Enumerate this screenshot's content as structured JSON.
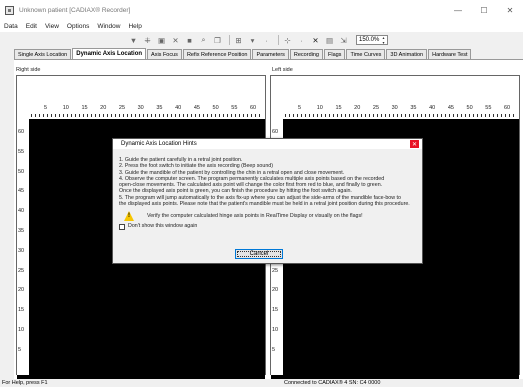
{
  "window": {
    "title": "Unknown patient [CADIAX® Recorder]",
    "minimize": "—",
    "maximize": "☐",
    "close": "✕"
  },
  "menu": [
    "Data",
    "Edit",
    "View",
    "Options",
    "Window",
    "Help"
  ],
  "toolbar": {
    "zoom": "150.0%"
  },
  "tabs": [
    {
      "label": "Single Axis Location",
      "active": false
    },
    {
      "label": "Dynamic Axis Location",
      "active": true
    },
    {
      "label": "Axis Focus",
      "active": false
    },
    {
      "label": "Refix Reference Position",
      "active": false
    },
    {
      "label": "Parameters",
      "active": false
    },
    {
      "label": "Recording",
      "active": false
    },
    {
      "label": "Flags",
      "active": false
    },
    {
      "label": "Time Curves",
      "active": false
    },
    {
      "label": "3D Animation",
      "active": false
    },
    {
      "label": "Hardware Test",
      "active": false
    }
  ],
  "panels": {
    "right_side": "Right side",
    "left_side": "Left side"
  },
  "ruler": {
    "top_ticks": [
      "5",
      "10",
      "15",
      "20",
      "25",
      "30",
      "35",
      "40",
      "45",
      "50",
      "55",
      "60"
    ],
    "left_ticks": [
      "60",
      "55",
      "50",
      "45",
      "40",
      "35",
      "30",
      "25",
      "20",
      "15",
      "10",
      "5"
    ]
  },
  "dialog": {
    "title": "Dynamic Axis Location Hints",
    "lines": [
      "1. Guide the patient carefully in a retral joint position.",
      "2. Press the foot switch to initiate the axis recording (Beep sound)",
      "3. Guide the mandible of the patient by controlling the chin in a retral open and close movement.",
      "4. Observe the computer screen. The program permanently calculates multiple axis points based on the recorded",
      "open-close movements. The calculated axis point will change the color first from red to blue, and finally to green.",
      "Once the displayed axis point is green, you can finish the procedure by hitting the foot switch again.",
      "5. The program will jump automatically to the axis fix-up where you can adjust the side-arms of the mandible face-bow to",
      "the displayed axis points. Please note that the patient's mandible must be held in a retral joint position during this procedure."
    ],
    "warning": "Verify the computer calculated hinge axis points in RealTime Display or visually on the flags!",
    "checkbox_label": "Don't show this window again",
    "cancel": "Cancel"
  },
  "status": {
    "left": "For Help, press F1",
    "center": "Connected to CADIAX® 4 SN: C4 0000"
  }
}
